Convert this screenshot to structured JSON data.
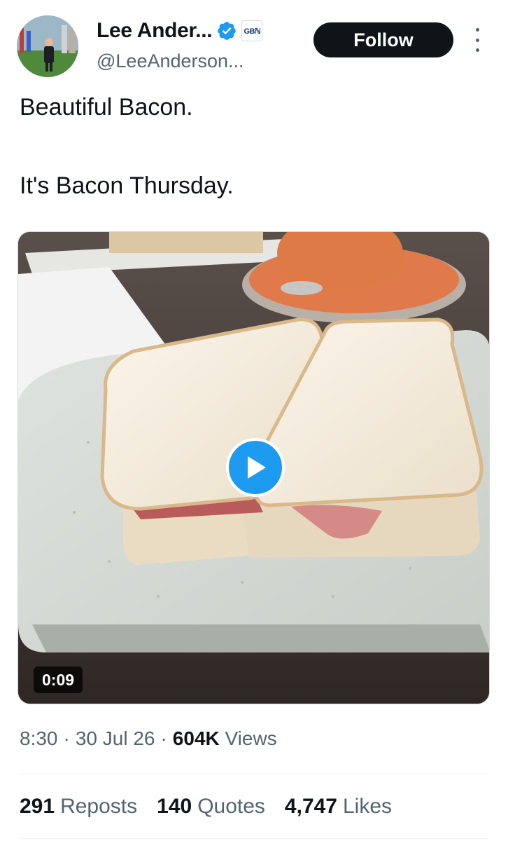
{
  "tweet": {
    "author": {
      "display_name": "Lee Ander...",
      "handle": "@LeeAnderson...",
      "affiliate_badge": "GBℕ",
      "verified_color": "#1d9bf0"
    },
    "follow_label": "Follow",
    "text_lines": [
      "Beautiful Bacon.",
      "It's Bacon Thursday."
    ],
    "media": {
      "type": "video",
      "duration": "0:09",
      "play_icon": "play-icon"
    },
    "meta": {
      "time": "8:30",
      "date": "30 Jul 26",
      "views_count": "604K",
      "views_label": "Views"
    },
    "stats": [
      {
        "count": "291",
        "label": "Reposts"
      },
      {
        "count": "140",
        "label": "Quotes"
      },
      {
        "count": "4,747",
        "label": "Likes"
      }
    ]
  },
  "colors": {
    "accent": "#1d9bf0",
    "text_primary": "#0f1419",
    "text_secondary": "#536471",
    "follow_bg": "#0f1419"
  }
}
